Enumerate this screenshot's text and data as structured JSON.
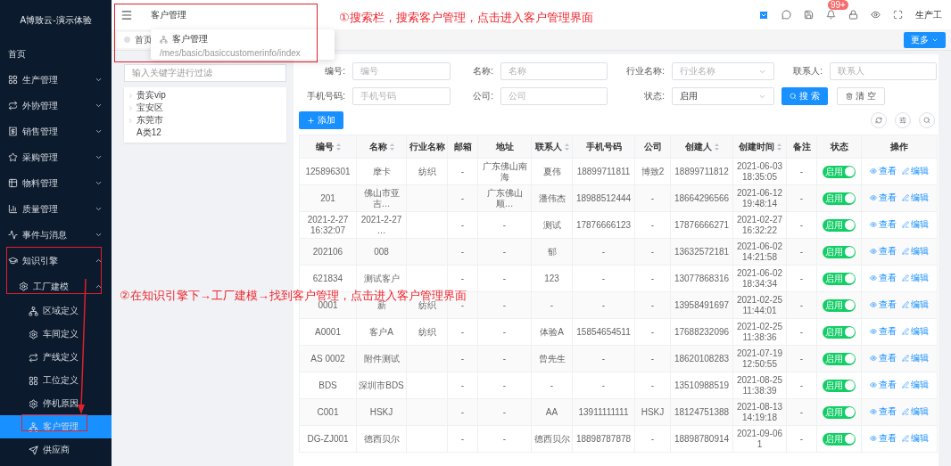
{
  "sidebar": {
    "title": "A博致云-演示体验",
    "items": [
      {
        "label": "首页",
        "selected": false
      },
      {
        "label": "生产管理",
        "selected": false,
        "expanded": false
      },
      {
        "label": "外协管理",
        "selected": false,
        "expanded": false
      },
      {
        "label": "销售管理",
        "selected": false,
        "expanded": false
      },
      {
        "label": "采购管理",
        "selected": false,
        "expanded": false
      },
      {
        "label": "物料管理",
        "selected": false,
        "expanded": false
      },
      {
        "label": "质量管理",
        "selected": false,
        "expanded": false
      },
      {
        "label": "事件与消息",
        "selected": false,
        "expanded": false
      },
      {
        "label": "知识引擎",
        "selected": false,
        "expanded": true,
        "children": [
          {
            "label": "工厂建模",
            "selected": false,
            "expanded": true,
            "children": [
              {
                "label": "区域定义",
                "selected": false
              },
              {
                "label": "车间定义",
                "selected": false
              },
              {
                "label": "产线定义",
                "selected": false
              },
              {
                "label": "工位定义",
                "selected": false
              },
              {
                "label": "停机原因",
                "selected": false
              },
              {
                "label": "客户管理",
                "selected": true
              },
              {
                "label": "供应商",
                "selected": false
              }
            ]
          }
        ]
      }
    ]
  },
  "header": {
    "search": {
      "value": "客户管理",
      "result": {
        "label": "客户管理",
        "path": "/mes/basic/basiccustomerinfo/index"
      }
    },
    "badge": "99+",
    "user": "生产工"
  },
  "tabs": [
    {
      "label": "首页",
      "selected": false
    }
  ],
  "more_button": "更多",
  "tree": {
    "placeholder": "输入关键字进行过滤",
    "items": [
      {
        "label": "贵宾vip",
        "expanded": false
      },
      {
        "label": "宝安区",
        "expanded": false
      },
      {
        "label": "东莞市",
        "expanded": false
      },
      {
        "label": "A类12"
      }
    ]
  },
  "filters": [
    {
      "kind": "input",
      "label": "编号:",
      "placeholder": "编号"
    },
    {
      "kind": "input",
      "label": "名称:",
      "placeholder": "名称"
    },
    {
      "kind": "select",
      "label": "行业名称:",
      "placeholder": "行业名称"
    },
    {
      "kind": "input",
      "label": "联系人:",
      "placeholder": "联系人"
    },
    {
      "kind": "input",
      "label": "手机号码:",
      "placeholder": "手机号码"
    },
    {
      "kind": "input",
      "label": "公司:",
      "placeholder": "公司"
    },
    {
      "kind": "select",
      "label": "状态:",
      "value": "启用"
    }
  ],
  "search_button": "搜 索",
  "clear_button": "清 空",
  "add_button": "添加",
  "table": {
    "columns": [
      {
        "label": "编号",
        "sortable": true
      },
      {
        "label": "名称",
        "sortable": true
      },
      {
        "label": "行业名称",
        "sortable": false
      },
      {
        "label": "邮箱",
        "sortable": false
      },
      {
        "label": "地址",
        "sortable": false
      },
      {
        "label": "联系人",
        "sortable": true
      },
      {
        "label": "手机号码",
        "sortable": false
      },
      {
        "label": "公司",
        "sortable": false
      },
      {
        "label": "创建人",
        "sortable": true
      },
      {
        "label": "创建时间",
        "sortable": true
      },
      {
        "label": "备注",
        "sortable": false
      },
      {
        "label": "状态",
        "sortable": false
      },
      {
        "label": "操作",
        "sortable": false
      }
    ],
    "rows": [
      {
        "code": "125896301",
        "name": "摩卡",
        "industry": "纺织",
        "email": "-",
        "address": "广东佛山南海",
        "contact": "夏伟",
        "phone": "18899711811",
        "company": "博致2",
        "creator": "18899711812",
        "created": "2021-06-03 18:35:05",
        "note": "-",
        "status": {
          "label": "启用",
          "on": true
        },
        "actions": [
          "查看",
          "编辑"
        ]
      },
      {
        "code": "201",
        "name": "佛山市亚吉…",
        "email": "-",
        "address": "广东佛山顺…",
        "contact": "潘伟杰",
        "phone": "18988512444",
        "company": "-",
        "creator": "18664296566",
        "created": "2021-06-12 19:48:14",
        "note": "-",
        "status": {
          "label": "启用",
          "on": true
        },
        "actions": [
          "查看",
          "编辑"
        ]
      },
      {
        "code": "2021-2-27 16:32:07",
        "name": "2021-2-27 …",
        "email": "-",
        "address": "-",
        "contact": "测试",
        "phone": "17876666123",
        "company": "-",
        "creator": "17876666271",
        "created": "2021-02-27 16:32:22",
        "note": "-",
        "status": {
          "label": "启用",
          "on": true
        },
        "actions": [
          "查看",
          "编辑"
        ]
      },
      {
        "code": "202106",
        "name": "008",
        "email": "-",
        "address": "-",
        "contact": "郁",
        "phone": "-",
        "company": "-",
        "creator": "13632572181",
        "created": "2021-06-02 14:21:58",
        "note": "-",
        "status": {
          "label": "启用",
          "on": true
        },
        "actions": [
          "查看",
          "编辑"
        ]
      },
      {
        "code": "621834",
        "name": "测试客户",
        "email": "-",
        "address": "-",
        "contact": "123",
        "phone": "-",
        "company": "-",
        "creator": "13077868316",
        "created": "2021-06-02 18:34:34",
        "note": "-",
        "status": {
          "label": "启用",
          "on": true
        },
        "actions": [
          "查看",
          "编辑"
        ]
      },
      {
        "code": "0001",
        "name": "新",
        "industry": "纺织",
        "email": "-",
        "address": "-",
        "contact": "-",
        "phone": "-",
        "company": "-",
        "creator": "13958491697",
        "created": "2021-02-25 11:44:01",
        "note": "-",
        "status": {
          "label": "启用",
          "on": true
        },
        "actions": [
          "查看",
          "编辑"
        ]
      },
      {
        "code": "A0001",
        "name": "客户A",
        "industry": "纺织",
        "email": "-",
        "address": "-",
        "contact": "体验A",
        "phone": "15854654511",
        "company": "-",
        "creator": "17688232096",
        "created": "2021-02-25 11:38:36",
        "note": "-",
        "status": {
          "label": "启用",
          "on": true
        },
        "actions": [
          "查看",
          "编辑"
        ]
      },
      {
        "code": "AS 0002",
        "name": "附件测试",
        "email": "-",
        "address": "-",
        "contact": "曾先生",
        "phone": "-",
        "company": "-",
        "creator": "18620108283",
        "created": "2021-07-19 12:50:55",
        "note": "-",
        "status": {
          "label": "启用",
          "on": true
        },
        "actions": [
          "查看",
          "编辑"
        ]
      },
      {
        "code": "BDS",
        "name": "深圳市BDS",
        "email": "-",
        "address": "-",
        "contact": "-",
        "phone": "-",
        "company": "-",
        "creator": "13510988519",
        "created": "2021-08-25 11:38:39",
        "note": "-",
        "status": {
          "label": "启用",
          "on": true
        },
        "actions": [
          "查看",
          "编辑"
        ]
      },
      {
        "code": "C001",
        "name": "HSKJ",
        "email": "-",
        "address": "-",
        "contact": "AA",
        "phone": "13911111111",
        "company": "HSKJ",
        "creator": "18124751388",
        "created": "2021-08-13 14:19:18",
        "note": "-",
        "status": {
          "label": "启用",
          "on": true
        },
        "actions": [
          "查看",
          "编辑"
        ]
      },
      {
        "code": "DG-ZJ001",
        "name": "德西贝尔",
        "email": "-",
        "address": "-",
        "contact": "德西贝尔",
        "phone": "18898787878",
        "company": "-",
        "creator": "18898780914",
        "created": "2021-09-06 1",
        "note": "-",
        "status": {
          "label": "启用",
          "on": true
        },
        "actions": [
          "查看",
          "编辑"
        ]
      }
    ]
  },
  "annotations": [
    "①搜索栏，搜索客户管理，点击进入客户管理界面",
    "②在知识引擎下→工厂建模→找到客户管理，点击进入客户管理界面"
  ]
}
